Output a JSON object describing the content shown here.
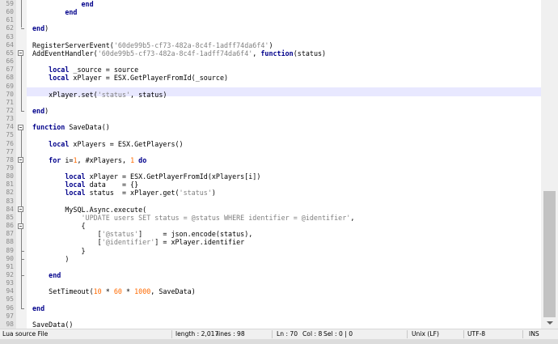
{
  "editor": {
    "lines": [
      {
        "n": "59",
        "segs": [
          {
            "t": "            ",
            "c": ""
          },
          {
            "t": "end",
            "c": "kw"
          }
        ]
      },
      {
        "n": "60",
        "segs": [
          {
            "t": "        ",
            "c": ""
          },
          {
            "t": "end",
            "c": "kw"
          }
        ]
      },
      {
        "n": "61",
        "segs": []
      },
      {
        "n": "62",
        "segs": [
          {
            "t": "end",
            "c": "kw"
          },
          {
            "t": ")",
            "c": ""
          }
        ]
      },
      {
        "n": "63",
        "segs": []
      },
      {
        "n": "64",
        "segs": [
          {
            "t": "RegisterServerEvent(",
            "c": ""
          },
          {
            "t": "'60de99b5-cf73-482a-8c4f-1adff74da6f4'",
            "c": "str"
          },
          {
            "t": ")",
            "c": ""
          }
        ]
      },
      {
        "n": "65",
        "segs": [
          {
            "t": "AddEventHandler(",
            "c": ""
          },
          {
            "t": "'60de99b5-cf73-482a-8c4f-1adff74da6f4'",
            "c": "str"
          },
          {
            "t": ", ",
            "c": ""
          },
          {
            "t": "function",
            "c": "kw"
          },
          {
            "t": "(status)",
            "c": ""
          }
        ]
      },
      {
        "n": "66",
        "segs": []
      },
      {
        "n": "67",
        "segs": [
          {
            "t": "    ",
            "c": ""
          },
          {
            "t": "local",
            "c": "kw"
          },
          {
            "t": " _source = source",
            "c": ""
          }
        ]
      },
      {
        "n": "68",
        "segs": [
          {
            "t": "    ",
            "c": ""
          },
          {
            "t": "local",
            "c": "kw"
          },
          {
            "t": " xPlayer = ESX.GetPlayerFromId(_source)",
            "c": ""
          }
        ]
      },
      {
        "n": "69",
        "segs": []
      },
      {
        "n": "70",
        "segs": [
          {
            "t": "    xPlayer.set(",
            "c": ""
          },
          {
            "t": "'status'",
            "c": "str"
          },
          {
            "t": ", status)",
            "c": ""
          }
        ]
      },
      {
        "n": "71",
        "segs": []
      },
      {
        "n": "72",
        "segs": [
          {
            "t": "end",
            "c": "kw"
          },
          {
            "t": ")",
            "c": ""
          }
        ]
      },
      {
        "n": "73",
        "segs": []
      },
      {
        "n": "74",
        "segs": [
          {
            "t": "function",
            "c": "kw"
          },
          {
            "t": " SaveData()",
            "c": ""
          }
        ]
      },
      {
        "n": "75",
        "segs": []
      },
      {
        "n": "76",
        "segs": [
          {
            "t": "    ",
            "c": ""
          },
          {
            "t": "local",
            "c": "kw"
          },
          {
            "t": " xPlayers = ESX.GetPlayers()",
            "c": ""
          }
        ]
      },
      {
        "n": "77",
        "segs": []
      },
      {
        "n": "78",
        "segs": [
          {
            "t": "    ",
            "c": ""
          },
          {
            "t": "for",
            "c": "kw"
          },
          {
            "t": " i=",
            "c": ""
          },
          {
            "t": "1",
            "c": "num"
          },
          {
            "t": ", #xPlayers, ",
            "c": ""
          },
          {
            "t": "1",
            "c": "num"
          },
          {
            "t": " ",
            "c": ""
          },
          {
            "t": "do",
            "c": "kw"
          }
        ]
      },
      {
        "n": "79",
        "segs": []
      },
      {
        "n": "80",
        "segs": [
          {
            "t": "        ",
            "c": ""
          },
          {
            "t": "local",
            "c": "kw"
          },
          {
            "t": " xPlayer = ESX.GetPlayerFromId(xPlayers[i])",
            "c": ""
          }
        ]
      },
      {
        "n": "81",
        "segs": [
          {
            "t": "        ",
            "c": ""
          },
          {
            "t": "local",
            "c": "kw"
          },
          {
            "t": " data    = {}",
            "c": ""
          }
        ]
      },
      {
        "n": "82",
        "segs": [
          {
            "t": "        ",
            "c": ""
          },
          {
            "t": "local",
            "c": "kw"
          },
          {
            "t": " status  = xPlayer.get(",
            "c": ""
          },
          {
            "t": "'status'",
            "c": "str"
          },
          {
            "t": ")",
            "c": ""
          }
        ]
      },
      {
        "n": "83",
        "segs": []
      },
      {
        "n": "84",
        "segs": [
          {
            "t": "        MySQL.Async.execute(",
            "c": ""
          }
        ]
      },
      {
        "n": "85",
        "segs": [
          {
            "t": "            ",
            "c": ""
          },
          {
            "t": "'UPDATE users SET status = @status WHERE identifier = @identifier'",
            "c": "str"
          },
          {
            "t": ",",
            "c": ""
          }
        ]
      },
      {
        "n": "86",
        "segs": [
          {
            "t": "            {",
            "c": ""
          }
        ]
      },
      {
        "n": "87",
        "segs": [
          {
            "t": "                [",
            "c": ""
          },
          {
            "t": "'@status'",
            "c": "str"
          },
          {
            "t": "]     = json.encode(status),",
            "c": ""
          }
        ]
      },
      {
        "n": "88",
        "segs": [
          {
            "t": "                [",
            "c": ""
          },
          {
            "t": "'@identifier'",
            "c": "str"
          },
          {
            "t": "] = xPlayer.identifier",
            "c": ""
          }
        ]
      },
      {
        "n": "89",
        "segs": [
          {
            "t": "            }",
            "c": ""
          }
        ]
      },
      {
        "n": "90",
        "segs": [
          {
            "t": "        )",
            "c": ""
          }
        ]
      },
      {
        "n": "91",
        "segs": []
      },
      {
        "n": "92",
        "segs": [
          {
            "t": "    ",
            "c": ""
          },
          {
            "t": "end",
            "c": "kw"
          }
        ]
      },
      {
        "n": "93",
        "segs": []
      },
      {
        "n": "94",
        "segs": [
          {
            "t": "    SetTimeout(",
            "c": ""
          },
          {
            "t": "10",
            "c": "num"
          },
          {
            "t": " * ",
            "c": ""
          },
          {
            "t": "60",
            "c": "num"
          },
          {
            "t": " * ",
            "c": ""
          },
          {
            "t": "1000",
            "c": "num"
          },
          {
            "t": ", SaveData)",
            "c": ""
          }
        ]
      },
      {
        "n": "95",
        "segs": []
      },
      {
        "n": "96",
        "segs": [
          {
            "t": "end",
            "c": "kw"
          }
        ]
      },
      {
        "n": "97",
        "segs": []
      },
      {
        "n": "98",
        "segs": [
          {
            "t": "SaveData()",
            "c": ""
          }
        ]
      }
    ],
    "current_line": "70"
  },
  "statusbar": {
    "language": "Lua source File",
    "length": "length : 2,017",
    "lines": "lines : 98",
    "ln": "Ln : 70",
    "col": "Col : 8",
    "sel": "Sel : 0 | 0",
    "eol": "Unix (LF)",
    "encoding": "UTF-8",
    "mode": "INS"
  },
  "colors": {
    "keyword": "#00008b",
    "string": "#808080",
    "number": "#ff6a00",
    "current_line_bg": "#e8e8ff",
    "gutter_bg": "#e4e4e4"
  }
}
